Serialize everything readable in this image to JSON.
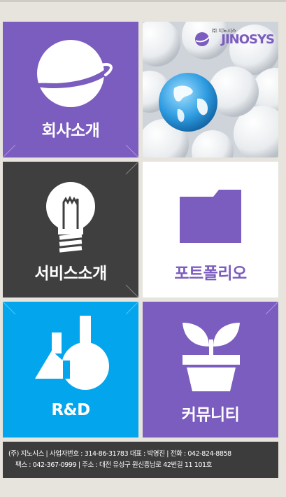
{
  "tiles": {
    "company": {
      "label": "회사소개"
    },
    "services": {
      "label": "서비스소개"
    },
    "portfolio": {
      "label": "포트폴리오"
    },
    "rnd": {
      "label": "R&D"
    },
    "community": {
      "label": "커뮤니티"
    }
  },
  "logo": {
    "small_text": "㈜ 지노시스",
    "brand": "JINOSYS"
  },
  "footer": {
    "line1": "(주) 지노시스 | 사업자번호 : 314-86-31783 대표 : 박영진 | 전화 : 042-824-8858",
    "line2": "팩스 : 042-367-0999  | 주소 : 대전 유성구 원신흥남로 42번길 11 101호"
  },
  "colors": {
    "purple": "#7b5cbf",
    "dark": "#3f3f3f",
    "blue": "#03a5ec",
    "background": "#e6e4dd"
  },
  "icons": {
    "company": "planet-icon",
    "services": "lightbulb-icon",
    "portfolio": "folder-icon",
    "rnd": "lab-flask-icon",
    "community": "sprout-pot-icon"
  }
}
